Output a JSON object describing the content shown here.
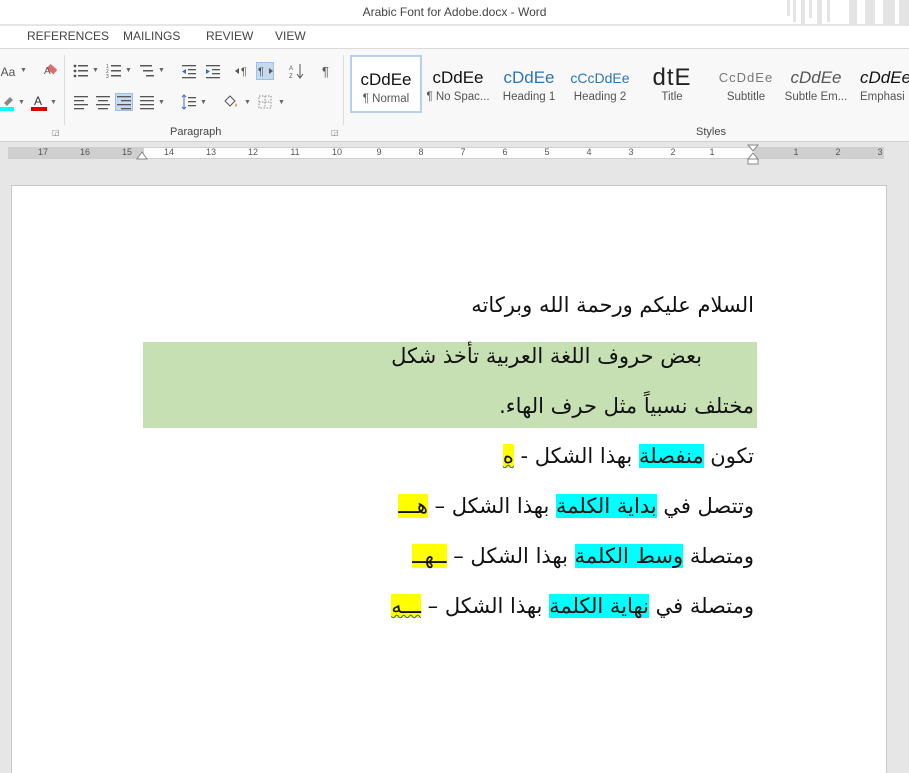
{
  "window": {
    "title": "Arabic Font for Adobe.docx - Word"
  },
  "menu_tabs": [
    "REFERENCES",
    "MAILINGS",
    "REVIEW",
    "VIEW"
  ],
  "ribbon": {
    "font_group": {
      "change_case": "Aa"
    },
    "paragraph_group": {
      "label": "Paragraph"
    },
    "styles_group": {
      "label": "Styles",
      "items": [
        {
          "sample": "cDdEe",
          "name": "¶ Normal",
          "selected": true
        },
        {
          "sample": "cDdEe",
          "name": "¶ No Spac..."
        },
        {
          "sample": "cDdEe",
          "name": "Heading 1"
        },
        {
          "sample": "cCcDdEe",
          "name": "Heading 2"
        },
        {
          "sample": "dtE",
          "name": "Title"
        },
        {
          "sample": "CcDdEe",
          "name": "Subtitle"
        },
        {
          "sample": "cDdEe",
          "name": "Subtle Em..."
        },
        {
          "sample": "cDdEe",
          "name": "Emphasi"
        }
      ]
    }
  },
  "ruler": {
    "numbers": [
      "17",
      "16",
      "15",
      "14",
      "13",
      "12",
      "11",
      "10",
      "9",
      "8",
      "7",
      "6",
      "5",
      "4",
      "3",
      "2",
      "1",
      "1",
      "2",
      "3"
    ]
  },
  "document": {
    "line1": "السلام عليكم ورحمة الله وبركاته",
    "line2": "بعض حروف اللغة العربية تأخذ شكل",
    "line3": "مختلف نسبياً مثل حرف الهاء.",
    "line4": {
      "a": "تكون ",
      "b": "منفصلة",
      "c": " بهذا الشكل  -  ",
      "d": "ه"
    },
    "line5": {
      "a": "وتتصل في ",
      "b": "بداية الكلمة",
      "c": " بهذا الشكل – ",
      "d": "هـــ"
    },
    "line6": {
      "a": "ومتصلة ",
      "b": "وسط الكلمة",
      "c": " بهذا الشكل  –  ",
      "d": "ــهــ"
    },
    "line7": {
      "a": "ومتصلة في ",
      "b": "نهاية الكلمة",
      "c": " بهذا الشكل – ",
      "d": "ـــه"
    }
  },
  "colors": {
    "highlight_green": "#c6e0b4",
    "highlight_cyan": "#00ffff",
    "highlight_yellow": "#ffff00"
  }
}
